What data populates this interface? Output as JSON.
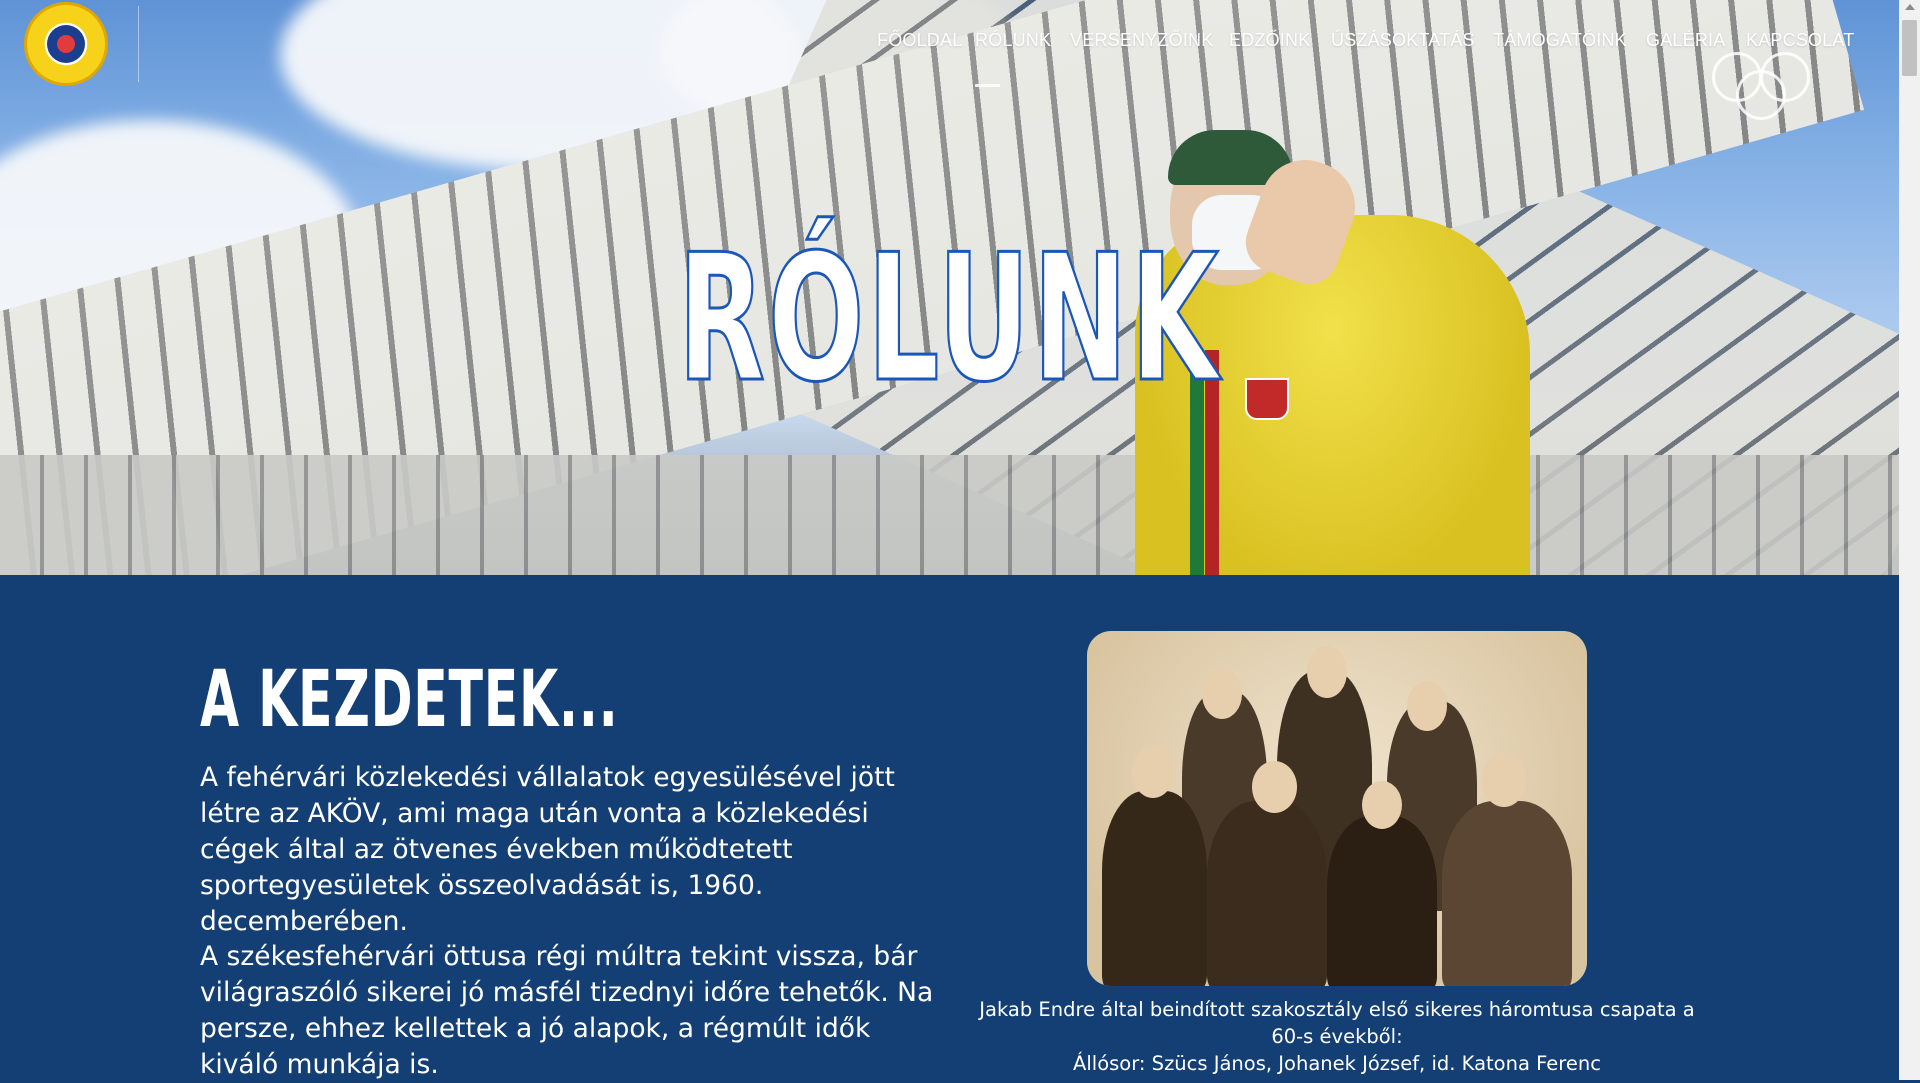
{
  "header": {
    "logo_name": "club-logo",
    "nav": [
      {
        "label": "FŐOLDAL",
        "active": false
      },
      {
        "label": "RÓLUNK",
        "active": true
      },
      {
        "label": "VERSENYZŐINK",
        "active": false
      },
      {
        "label": "EDZŐINK",
        "active": false
      },
      {
        "label": "ÚSZÁSOKTATÁS",
        "active": false
      },
      {
        "label": "TÁMOGATÓINK",
        "active": false
      },
      {
        "label": "GALÉRIA",
        "active": false
      },
      {
        "label": "KAPCSOLAT",
        "active": false
      }
    ]
  },
  "hero": {
    "title": "RÓLUNK"
  },
  "main": {
    "heading": "A KEZDETEK...",
    "paragraphs": [
      "A fehérvári közlekedési vállalatok egyesülésével jött létre az AKÖV, ami maga után vonta a közlekedési cégek által az ötvenes években működtetett sportegyesületek összeolvadását is, 1960. decemberében.",
      "A székesfehérvári öttusa régi múltra tekint vissza, bár világraszóló sikerei jó másfél tizednyi időre tehetők. Na persze, ehhez kellettek a jó alapok, a régmúlt idők kiváló munkája is."
    ],
    "photo_caption_line1": "Jakab Endre által beindított szakosztály első sikeres háromtusa csapata a 60-s évekből:",
    "photo_caption_line2": "Állósor: Szücs János, Johanek József, id. Katona Ferenc"
  },
  "colors": {
    "content_bg": "#133f75",
    "title_stroke": "#1b57b8",
    "text": "#ffffff"
  }
}
